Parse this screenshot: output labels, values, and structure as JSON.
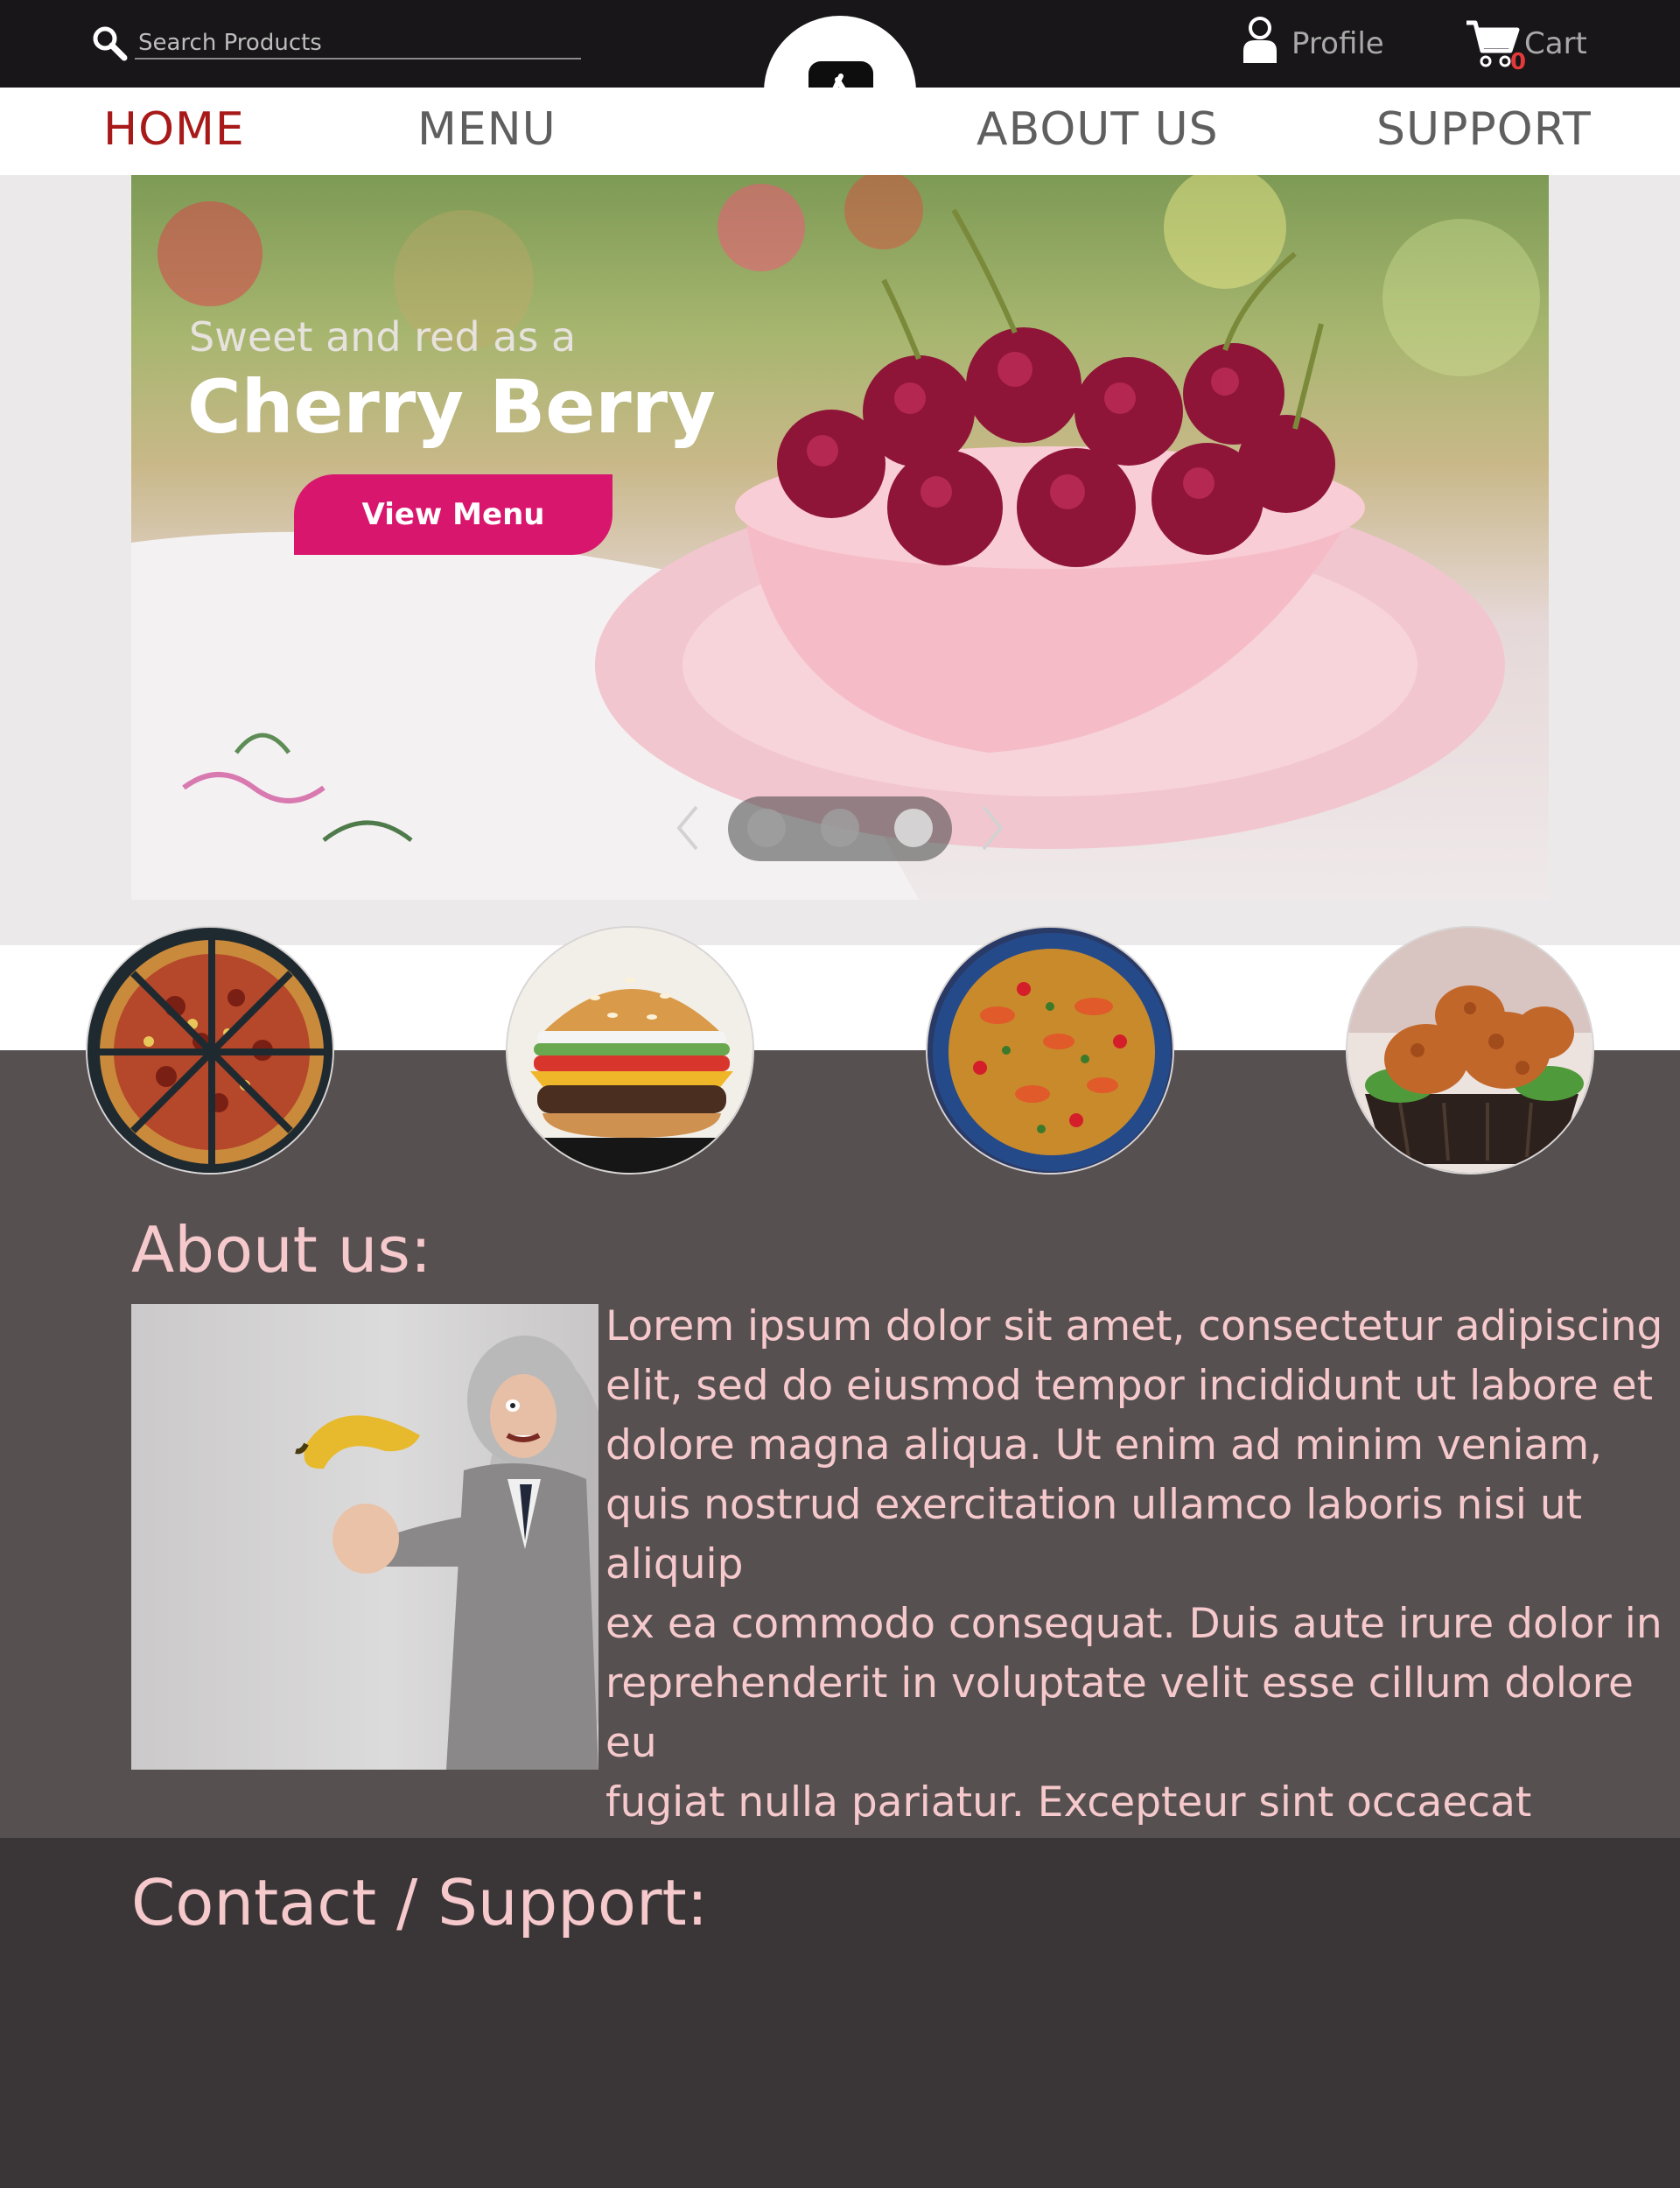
{
  "search": {
    "placeholder": "Search Products",
    "icon": "search-icon"
  },
  "header": {
    "profile_label": "Profile",
    "cart_label": "Cart",
    "cart_count": "0",
    "logo_icon": "app-store-icon"
  },
  "nav": {
    "items": [
      {
        "label": "HOME",
        "active": true
      },
      {
        "label": "MENU",
        "active": false
      },
      {
        "label": "ABOUT US",
        "active": false
      },
      {
        "label": "SUPPORT",
        "active": false
      }
    ]
  },
  "hero": {
    "subtitle": "Sweet and red as a",
    "title": "Cherry Berry",
    "button_label": "View Menu",
    "slides": 3,
    "active_slide": 3
  },
  "food_items": [
    "pizza",
    "burger",
    "paella",
    "fried-chicken"
  ],
  "about": {
    "title": "About us:",
    "text": "    Lorem ipsum dolor sit amet, consectetur adipiscing\nelit, sed do eiusmod tempor incididunt ut labore et\ndolore magna aliqua. Ut enim ad minim veniam,\nquis nostrud exercitation ullamco laboris nisi ut aliquip\nex ea commodo consequat. Duis aute irure dolor in\nreprehenderit in voluptate velit esse cillum dolore eu\nfugiat nulla pariatur. Excepteur sint occaecat cupidatat\nnon proident, sunt in culpa qui officia deserunt mollit."
  },
  "contact": {
    "title": "Contact / Support:"
  },
  "colors": {
    "topbar": "#181618",
    "accent_red": "#a81a1a",
    "button_pink": "#d9166d",
    "about_bg": "#565051",
    "contact_bg": "#3a3536",
    "heading_pink": "#f6c9cc"
  }
}
